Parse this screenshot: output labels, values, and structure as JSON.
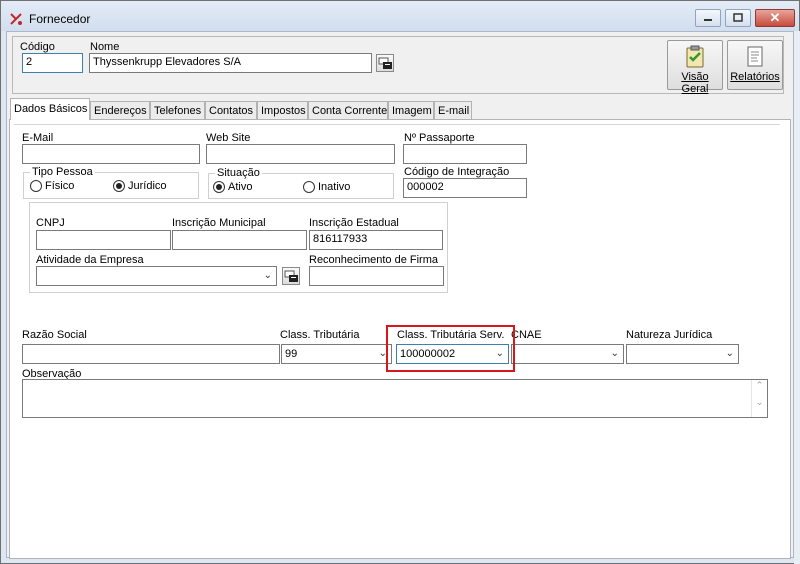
{
  "window": {
    "title": "Fornecedor"
  },
  "header": {
    "codigo_label": "Código",
    "codigo_value": "2",
    "nome_label": "Nome",
    "nome_value": "Thyssenkrupp Elevadores S/A",
    "visao_geral_label": "Visão Geral",
    "relatorios_label": "Relatórios"
  },
  "tabs": [
    {
      "label": "Dados Básicos"
    },
    {
      "label": "Endereços"
    },
    {
      "label": "Telefones"
    },
    {
      "label": "Contatos"
    },
    {
      "label": "Impostos"
    },
    {
      "label": "Conta Corrente"
    },
    {
      "label": "Imagem"
    },
    {
      "label": "E-mail"
    }
  ],
  "form": {
    "email_label": "E-Mail",
    "email_value": "",
    "website_label": "Web Site",
    "website_value": "",
    "passaporte_label": "Nº Passaporte",
    "passaporte_value": "",
    "tipo_pessoa": {
      "label": "Tipo Pessoa",
      "options": [
        "Físico",
        "Jurídico"
      ],
      "selected": "Jurídico"
    },
    "situacao": {
      "label": "Situação",
      "options": [
        "Ativo",
        "Inativo"
      ],
      "selected": "Ativo"
    },
    "codigo_integracao_label": "Código de Integração",
    "codigo_integracao_value": "000002",
    "cnpj_label": "CNPJ",
    "cnpj_value": "",
    "inscricao_municipal_label": "Inscrição Municipal",
    "inscricao_municipal_value": "",
    "inscricao_estadual_label": "Inscrição Estadual",
    "inscricao_estadual_value": "816117933",
    "atividade_label": "Atividade da Empresa",
    "atividade_value": "",
    "reconhecimento_label": "Reconhecimento de Firma",
    "reconhecimento_value": "",
    "razao_social_label": "Razão Social",
    "razao_social_value": "",
    "class_trib_label": "Class. Tributária",
    "class_trib_value": "99",
    "class_trib_serv_label": "Class. Tributária Serv.",
    "class_trib_serv_value": "100000002",
    "cnae_label": "CNAE",
    "cnae_value": "",
    "natureza_label": "Natureza Jurídica",
    "natureza_value": "",
    "observacao_label": "Observação",
    "observacao_value": ""
  },
  "colors": {
    "highlight": "#d9171b",
    "accent_border": "#3c7fb1"
  },
  "icons": [
    "app-logo-icon",
    "minimize-icon",
    "maximize-icon",
    "close-icon",
    "lookup-icon",
    "clipboard-check-icon",
    "report-icon",
    "chevron-down-icon"
  ]
}
